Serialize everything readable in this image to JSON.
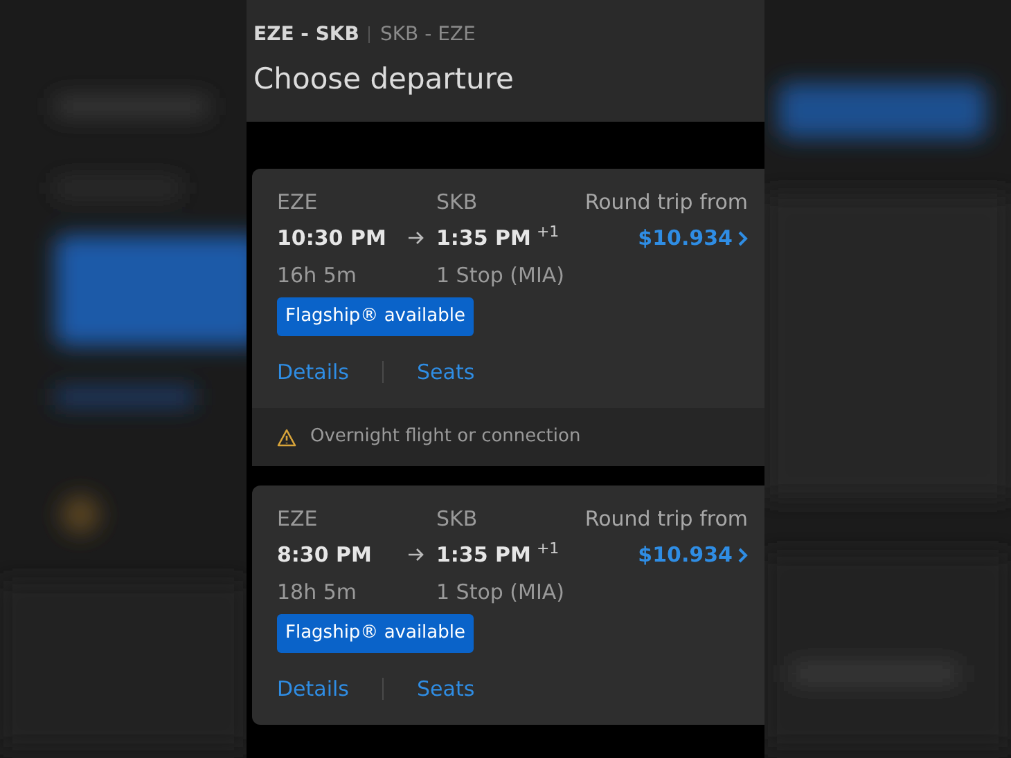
{
  "trip_tabs": [
    {
      "label": "EZE - SKB",
      "selected": true
    },
    {
      "label": "SKB - EZE",
      "selected": false
    }
  ],
  "title": "Choose departure",
  "flights": [
    {
      "origin": "EZE",
      "destination": "SKB",
      "depart_time": "10:30 PM",
      "arrive_time": "1:35 PM",
      "day_offset": "+1",
      "duration": "16h 5m",
      "stops": "1 Stop (MIA)",
      "price_label": "Round trip from",
      "price": "$10.934",
      "badge": "Flagship® available",
      "links": [
        "Details",
        "Seats"
      ],
      "notice": "Overnight flight or connection"
    },
    {
      "origin": "EZE",
      "destination": "SKB",
      "depart_time": "8:30 PM",
      "arrive_time": "1:35 PM",
      "day_offset": "+1",
      "duration": "18h 5m",
      "stops": "1 Stop (MIA)",
      "price_label": "Round trip from",
      "price": "$10.934",
      "badge": "Flagship® available",
      "links": [
        "Details",
        "Seats"
      ]
    }
  ]
}
